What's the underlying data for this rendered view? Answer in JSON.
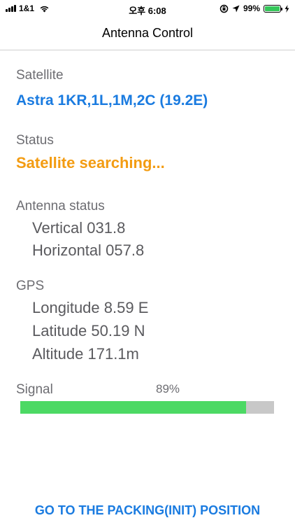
{
  "status_bar": {
    "carrier": "1&1",
    "time": "오후 6:08",
    "battery": "99%",
    "battery_level": 0.99
  },
  "nav": {
    "title": "Antenna Control"
  },
  "satellite": {
    "label": "Satellite",
    "value": "Astra 1KR,1L,1M,2C (19.2E)"
  },
  "status": {
    "label": "Status",
    "value": "Satellite searching..."
  },
  "antenna_status": {
    "label": "Antenna status",
    "vertical": "Vertical 031.8",
    "horizontal": "Horizontal 057.8"
  },
  "gps": {
    "label": "GPS",
    "longitude": "Longitude 8.59 E",
    "latitude": "Latitude 50.19 N",
    "altitude": "Altitude 171.1m"
  },
  "signal": {
    "label": "Signal",
    "percent_text": "89%",
    "level": 0.89
  },
  "action": {
    "label": "GO TO THE PACKING(INIT) POSITION"
  },
  "colors": {
    "accent": "#1a7be0",
    "warning": "#f39c12",
    "signal_fill": "#4cd964",
    "battery_fill": "#34c759"
  }
}
